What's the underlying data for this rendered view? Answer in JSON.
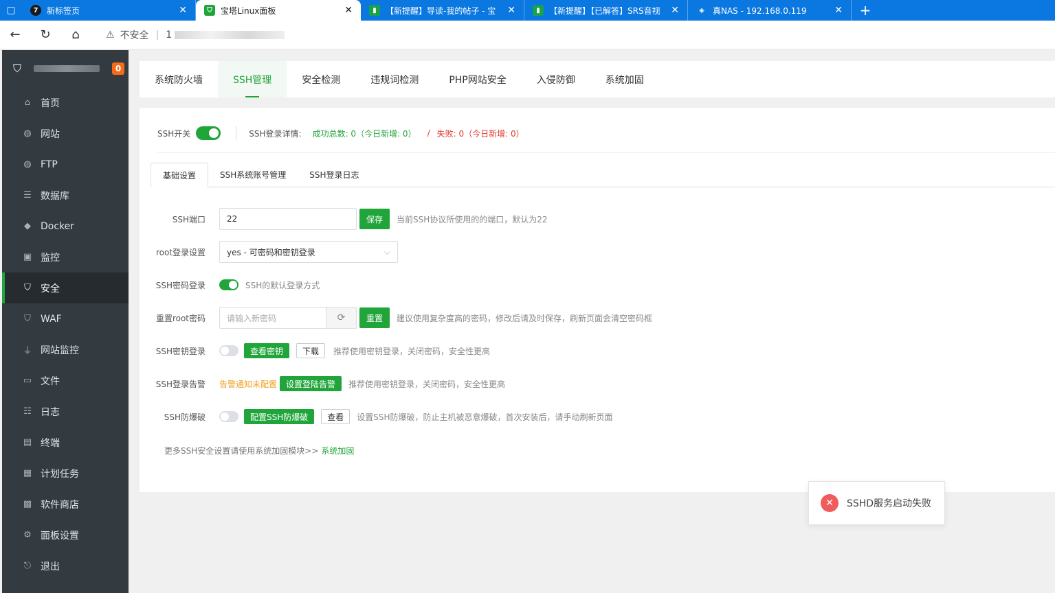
{
  "browser": {
    "tabs": [
      {
        "title": "新标签页",
        "active": false
      },
      {
        "title": "宝塔Linux面板",
        "active": true
      },
      {
        "title": "【新提醒】导读-我的帖子 - 宝",
        "active": false
      },
      {
        "title": "【新提醒】【已解答】SRS音视",
        "active": false
      },
      {
        "title": "真NAS - 192.168.0.119",
        "active": false
      }
    ],
    "insecure_label": "不安全",
    "url_prefix": "1"
  },
  "sidebar": {
    "badge": "0",
    "items": [
      {
        "label": "首页",
        "icon": "home-icon",
        "glyph": "⌂"
      },
      {
        "label": "网站",
        "icon": "globe-icon",
        "glyph": "◍"
      },
      {
        "label": "FTP",
        "icon": "ftp-icon",
        "glyph": "◍"
      },
      {
        "label": "数据库",
        "icon": "database-icon",
        "glyph": "☰"
      },
      {
        "label": "Docker",
        "icon": "docker-icon",
        "glyph": "◆"
      },
      {
        "label": "监控",
        "icon": "monitor-icon",
        "glyph": "▣"
      },
      {
        "label": "安全",
        "icon": "shield-icon",
        "glyph": "⛉"
      },
      {
        "label": "WAF",
        "icon": "waf-icon",
        "glyph": "⛉"
      },
      {
        "label": "网站监控",
        "icon": "chart-icon",
        "glyph": "⏚"
      },
      {
        "label": "文件",
        "icon": "folder-icon",
        "glyph": "▭"
      },
      {
        "label": "日志",
        "icon": "log-icon",
        "glyph": "☷"
      },
      {
        "label": "终端",
        "icon": "terminal-icon",
        "glyph": "▤"
      },
      {
        "label": "计划任务",
        "icon": "calendar-icon",
        "glyph": "▦"
      },
      {
        "label": "软件商店",
        "icon": "apps-icon",
        "glyph": "▩"
      },
      {
        "label": "面板设置",
        "icon": "gear-icon",
        "glyph": "⚙"
      },
      {
        "label": "退出",
        "icon": "logout-icon",
        "glyph": "⎋"
      }
    ],
    "active_index": 6
  },
  "main_tabs": [
    "系统防火墙",
    "SSH管理",
    "安全检测",
    "违规词检测",
    "PHP网站安全",
    "入侵防御",
    "系统加固"
  ],
  "main_tab_active": 1,
  "ssh": {
    "switch_label": "SSH开关",
    "switch_on": true,
    "details_label": "SSH登录详情:",
    "success_text": "成功总数: 0（今日新增: 0）",
    "slash": "/",
    "fail_text": "失败: 0（今日新增: 0）"
  },
  "sub_tabs": [
    "基础设置",
    "SSH系统账号管理",
    "SSH登录日志"
  ],
  "sub_tab_active": 0,
  "form": {
    "port_label": "SSH端口",
    "port_value": "22",
    "port_save": "保存",
    "port_hint": "当前SSH协议所使用的的端口，默认为22",
    "root_label": "root登录设置",
    "root_value": "yes - 可密码和密钥登录",
    "pwd_login_label": "SSH密码登录",
    "pwd_login_on": true,
    "pwd_login_hint": "SSH的默认登录方式",
    "reset_label": "重置root密码",
    "reset_placeholder": "请输入新密码",
    "reset_button": "重置",
    "reset_hint": "建议使用复杂度高的密码，修改后请及时保存，刷新页面会清空密码框",
    "key_label": "SSH密钥登录",
    "key_on": false,
    "key_view": "查看密钥",
    "key_download": "下载",
    "key_hint": "推荐使用密钥登录，关闭密码，安全性更高",
    "alert_label": "SSH登录告警",
    "alert_status": "告警通知未配置",
    "alert_button": "设置登陆告警",
    "alert_hint": "推荐使用密钥登录，关闭密码，安全性更高",
    "brute_label": "SSH防爆破",
    "brute_on": false,
    "brute_button": "配置SSH防爆破",
    "brute_view": "查看",
    "brute_hint": "设置SSH防爆破，防止主机被恶意爆破，首次安装后，请手动刷新页面"
  },
  "more": {
    "text": "更多SSH安全设置请使用系统加固模块>>",
    "link": "系统加固"
  },
  "toast": {
    "message": "SSHD服务启动失败"
  },
  "colors": {
    "accent": "#20a53a",
    "sidebar_bg": "#333a40",
    "error": "#f05b5b",
    "browser_tabbar": "#0a78e0"
  }
}
